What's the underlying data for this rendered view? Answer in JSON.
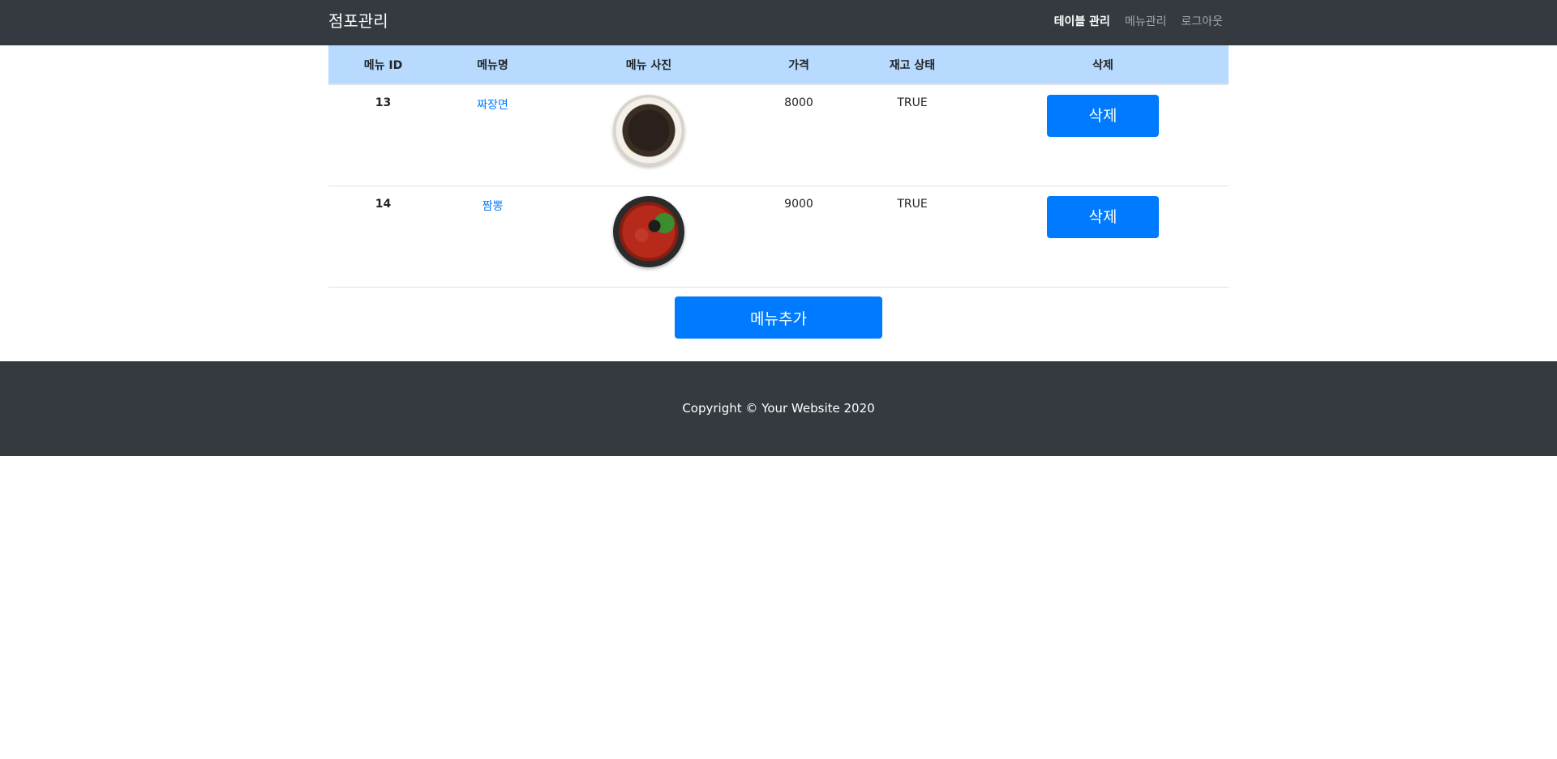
{
  "navbar": {
    "brand": "점포관리",
    "links": [
      {
        "label": "테이블 관리"
      },
      {
        "label": "메뉴관리"
      },
      {
        "label": "로그아웃"
      }
    ]
  },
  "table": {
    "headers": [
      "메뉴 ID",
      "메뉴명",
      "메뉴 사진",
      "가격",
      "재고 상태",
      "삭제"
    ],
    "rows": [
      {
        "id": "13",
        "name": "짜장면",
        "photo_icon": "jjajangmyeon-photo",
        "price": "8000",
        "stock": "TRUE",
        "delete_label": "삭제"
      },
      {
        "id": "14",
        "name": "짬뽕",
        "photo_icon": "jjamppong-photo",
        "price": "9000",
        "stock": "TRUE",
        "delete_label": "삭제"
      }
    ]
  },
  "add_button": {
    "label": "메뉴추가"
  },
  "footer": {
    "text": "Copyright © Your Website 2020"
  },
  "colors": {
    "navbar": "#343a40",
    "header_row": "#b8daff",
    "primary": "#007bff"
  }
}
